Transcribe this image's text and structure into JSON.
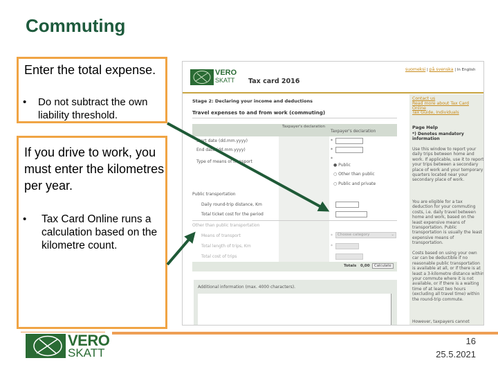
{
  "slide": {
    "title": "Commuting",
    "page_number": "16",
    "date": "25.5.2021",
    "accent": "#f0a444",
    "brand_green": "#1d5a3c"
  },
  "box1": {
    "lead": "Enter the total expense.",
    "bullet": "Do not subtract  the own liability threshold."
  },
  "box2": {
    "lead": "If you drive to work, you must enter the kilometres per year.",
    "bullet": "Tax Card Online runs a calculation based on the kilometre count."
  },
  "logo": {
    "line1": "VERO",
    "line2": "SKATT"
  },
  "screenshot": {
    "app_title": "Tax card 2016",
    "lang_links": [
      "suomeksi",
      "på svenska",
      "In English"
    ],
    "stage": "Stage 2: Declaring your income and deductions",
    "section_title": "Travel expenses to and from work (commuting)",
    "col_headers": [
      "Taxpayer's declaration",
      "Taxpayer's declaration"
    ],
    "fields": {
      "start_date": "Start date (dd.mm.yyyy)",
      "end_date": "End date (dd.mm.yyyy)",
      "transport_type": "Type of means of transport",
      "radio_options": [
        "Public",
        "Other than public",
        "Public and private"
      ],
      "public_header": "Public transportation",
      "daily_distance": "Daily round-trip distance, Km",
      "ticket_cost": "Total ticket cost for the period",
      "other_header": "Other than public transportation",
      "means": "Means of transport",
      "means_select": "Choose category",
      "length": "Total length of trips, Km",
      "trip_cost": "Total cost of trips",
      "totals_label": "Totals",
      "totals_value": "0,00",
      "calculate": "Calculate",
      "additional": "Additional information (max. 4000 characters)."
    },
    "sidebar": {
      "links": [
        "Contact us",
        "Read more about Tax Card Online",
        "Tax Guide, Individuals"
      ],
      "help_title": "Page Help",
      "mandatory": "*) Denotes mandatory information",
      "paragraphs": [
        "Use this window to report your daily trips between home and work.  If applicable, use it to report your trips between a secondary place of work and your temporary quarters located near your secondary place of work.",
        "You are eligible for a tax deduction for your commuting costs, i.e. daily travel between home and work, based on the least expensive means of transportation. Public transportation is usually the least expensive means of transportation.",
        "Costs based on using your own car can be deductible if no reasonable public transportation is available at all, or if there is at least a 3-kilometre distance within your commute where it is not available, or if there is a waiting time of at least two hours (excluding all travel time) within the round-trip commute.",
        "However, taxpayers cannot"
      ]
    }
  }
}
